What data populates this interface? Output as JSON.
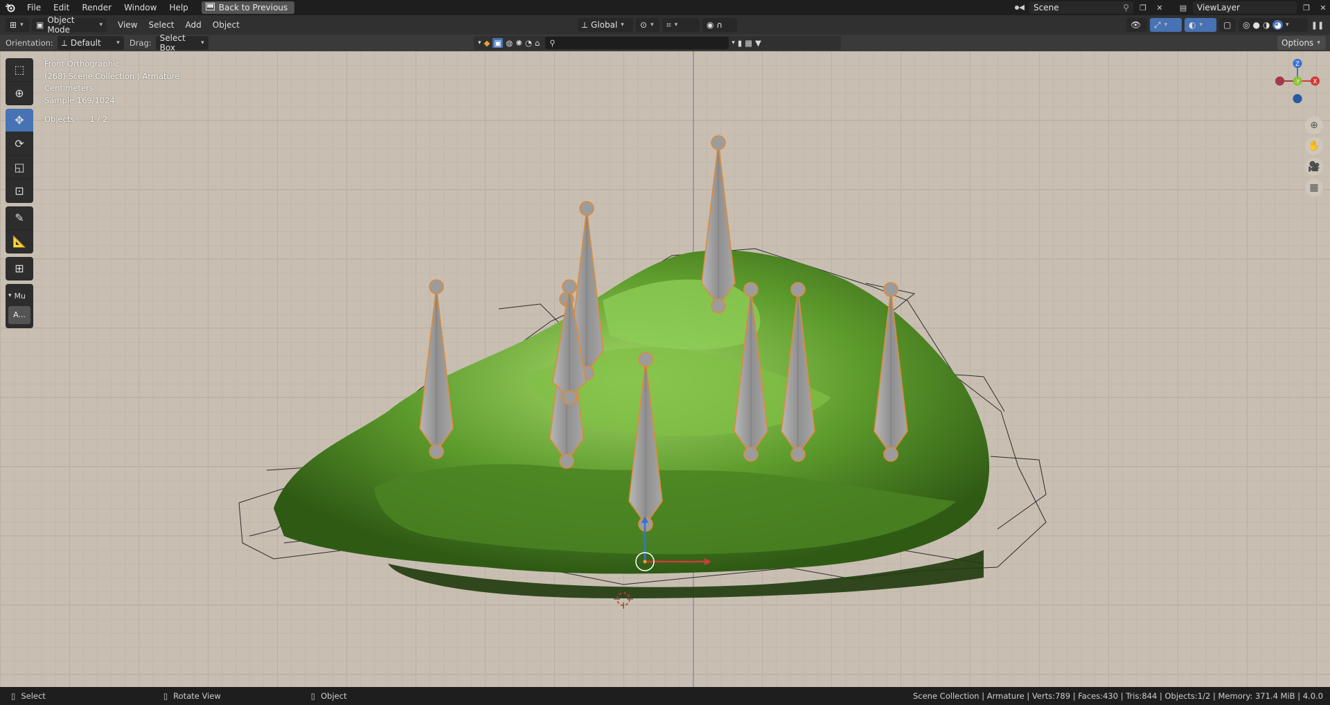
{
  "menubar": {
    "items": [
      "File",
      "Edit",
      "Render",
      "Window",
      "Help"
    ],
    "back_label": "Back to Previous",
    "scene": "Scene",
    "view_layer": "ViewLayer"
  },
  "header": {
    "mode": "Object Mode",
    "menus": [
      "View",
      "Select",
      "Add",
      "Object"
    ],
    "transform_orientation": "Global",
    "options_label": "Options"
  },
  "toolrow": {
    "orientation_label": "Orientation:",
    "orientation_value": "Default",
    "drag_label": "Drag:",
    "drag_value": "Select Box"
  },
  "viewport": {
    "view_name": "Front Orthographic",
    "collection_line": "(268) Scene Collection | Armature",
    "units": "Centimeters",
    "sample": "Sample 169/1024",
    "objects_label": "Objects",
    "objects_count": "1 / 2",
    "gizmo_labels": {
      "z": "Z",
      "y": "-Y",
      "x": "X"
    }
  },
  "toolbar": {
    "panel_label": "Mu",
    "panel_button": "A..."
  },
  "statusbar": {
    "select": "Select",
    "rotate": "Rotate View",
    "object": "Object",
    "stats": "Scene Collection | Armature | Verts:789 | Faces:430 | Tris:844 | Objects:1/2 | Memory: 371.4 MiB | 4.0.0"
  },
  "colors": {
    "accent": "#4772b3",
    "viewport_bg": "#c8bfb2",
    "bone_fill": "#9a9a9a",
    "bone_outline": "#e08a3a",
    "foliage": "#5a9a2a",
    "axis_x": "#d03a3a",
    "axis_y": "#8ac234",
    "axis_z": "#3a72d0"
  }
}
